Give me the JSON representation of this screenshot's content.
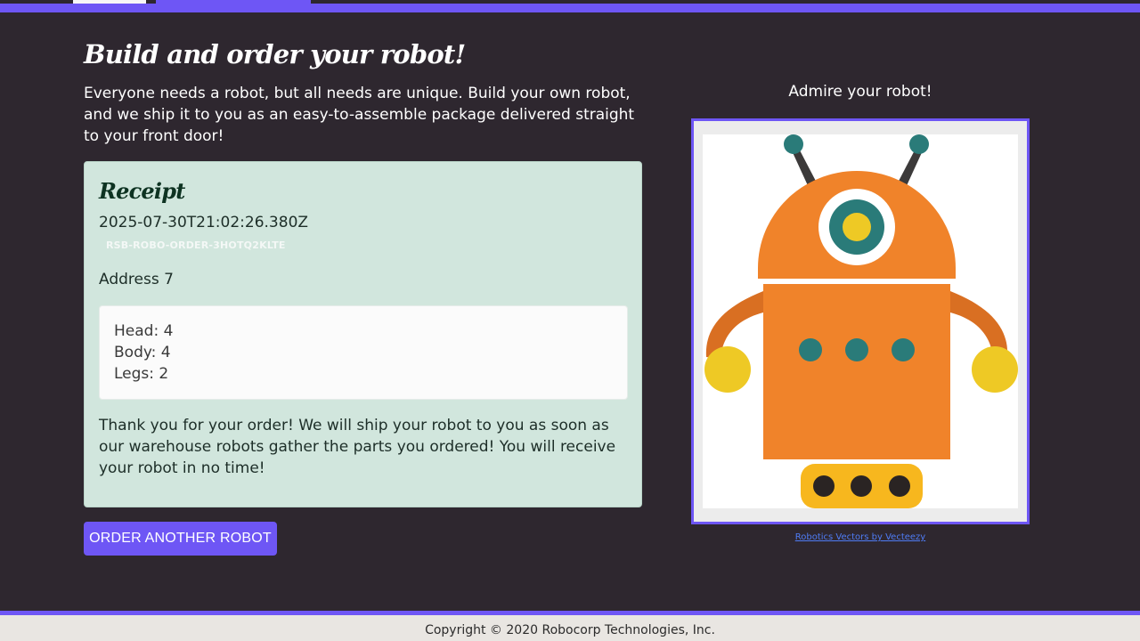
{
  "page": {
    "title": "Build and order your robot!",
    "intro": "Everyone needs a robot, but all needs are unique. Build your own robot, and we ship it to you as an easy-to-assemble package delivered straight to your front door!"
  },
  "receipt": {
    "title": "Receipt",
    "date": "2025-07-30T21:02:26.380Z",
    "order_id": "RSB-ROBO-ORDER-3HOTQ2KLTE",
    "address": "Address 7",
    "parts": {
      "head": "Head: 4",
      "body": "Body: 4",
      "legs": "Legs: 2"
    },
    "thanks": "Thank you for your order! We will ship your robot to you as soon as our warehouse robots gather the parts you ordered! You will receive your robot in no time!"
  },
  "actions": {
    "order_another": "ORDER ANOTHER ROBOT"
  },
  "preview": {
    "heading": "Admire your robot!",
    "credit": "Robotics Vectors by Vecteezy"
  },
  "footer": {
    "copyright": "Copyright © 2020 Robocorp Technologies, Inc."
  },
  "colors": {
    "accent": "#6e56f5",
    "background": "#2e272f",
    "receipt_bg": "#d1e6dd",
    "robot_orange": "#f0832a",
    "robot_teal": "#2a7b79",
    "robot_yellow": "#eec925"
  }
}
